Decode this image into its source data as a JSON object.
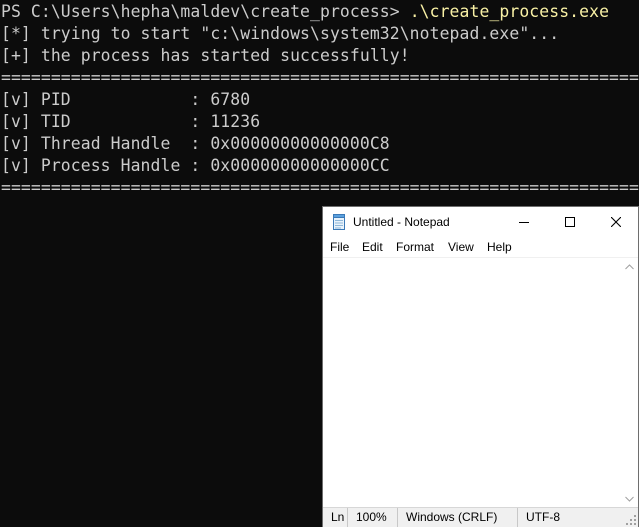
{
  "terminal": {
    "prompt": "PS C:\\Users\\hepha\\maldev\\create_process> ",
    "command": ".\\create_process.exe",
    "lines": [
      "[*] trying to start \"c:\\windows\\system32\\notepad.exe\"...",
      "[+] the process has started successfully!",
      "==========================================================================",
      "[v] PID            : 6780",
      "[v] TID            : 11236",
      "[v] Thread Handle  : 0x00000000000000C8",
      "[v] Process Handle : 0x00000000000000CC",
      "=========================================================================="
    ],
    "colors": {
      "background": "#0c0c0c",
      "text": "#cccccc",
      "command": "#f9f1a5"
    }
  },
  "notepad": {
    "title": "Untitled - Notepad",
    "app_icon": "notepad-icon",
    "menu": [
      "File",
      "Edit",
      "Format",
      "View",
      "Help"
    ],
    "content": "",
    "status": {
      "position": "Ln",
      "zoom": "100%",
      "line_endings": "Windows (CRLF)",
      "encoding": "UTF-8"
    }
  }
}
